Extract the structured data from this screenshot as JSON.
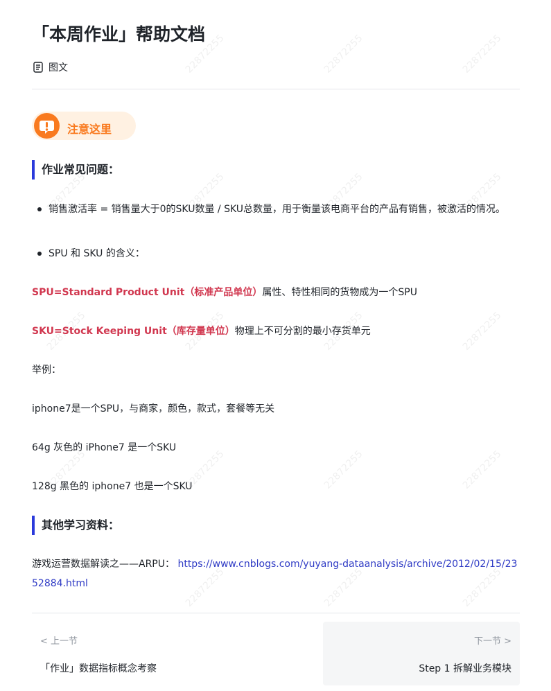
{
  "header": {
    "title": "「本周作业」帮助文档",
    "type_label": "图文"
  },
  "notice": {
    "label": "注意这里",
    "icon": "exclamation-icon",
    "color": "#f97a1f"
  },
  "section_faq": {
    "heading": "作业常见问题：",
    "bullets": [
      "销售激活率 = 销售量大于0的SKU数量 / SKU总数量，用于衡量该电商平台的产品有销售，被激活的情况。",
      "SPU 和 SKU 的含义："
    ],
    "spu_term": "SPU=Standard Product Unit（标准产品单位）",
    "spu_desc": "属性、特性相同的货物成为一个SPU",
    "sku_term": "SKU=Stock Keeping Unit（库存量单位）",
    "sku_desc": "物理上不可分割的最小存货单元",
    "example_label": "举例：",
    "examples": [
      "iphone7是一个SPU，与商家，颜色，款式，套餐等无关",
      "64g 灰色的 iPhone7 是一个SKU",
      "128g 黑色的 iphone7 也是一个SKU"
    ]
  },
  "section_resources": {
    "heading": "其他学习资料：",
    "resource_label": "游戏运营数据解读之——ARPU：",
    "resource_url": "https://www.cnblogs.com/yuyang-dataanalysis/archive/2012/02/15/2352884.html"
  },
  "watermark": "22872255",
  "navigation": {
    "prev_hint": "< 上一节",
    "prev_title": "「作业」数据指标概念考察",
    "next_hint": "下一节 >",
    "next_title": "Step 1 拆解业务模块"
  },
  "colors": {
    "accent_blue": "#2b3adb",
    "highlight_red": "#d1374f",
    "link": "#2f3bc5"
  }
}
